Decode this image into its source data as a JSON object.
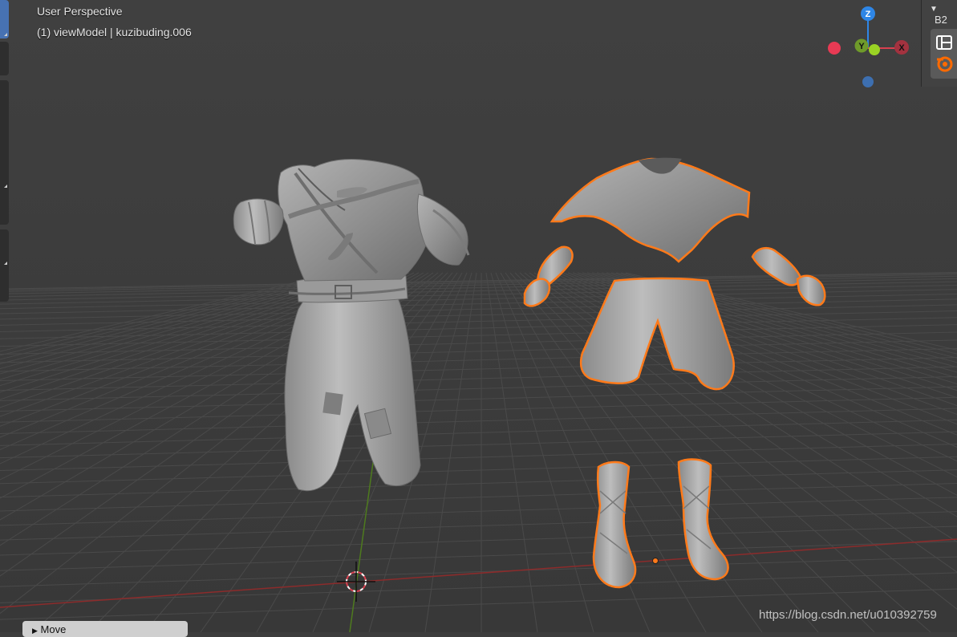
{
  "viewport": {
    "view_name": "User Perspective",
    "object_info": "(1) viewModel | kuzibuding.006"
  },
  "gizmo": {
    "z_label": "Z",
    "y_label": "Y",
    "x_label": "X",
    "colors": {
      "x": "#d9404f",
      "y": "#8fbf24",
      "z": "#2e86e6"
    }
  },
  "sidebar": {
    "header": "B2"
  },
  "operator_panel": {
    "label": "Move"
  },
  "watermark": "https://blog.csdn.net/u010392759",
  "colors": {
    "background": "#3d3d3d",
    "grid": "#4a4a4a",
    "selection_outline": "#ff7a1a",
    "x_axis": "#8c2b2b",
    "y_axis": "#4e7a1e",
    "mesh": "#9c9c9c"
  }
}
